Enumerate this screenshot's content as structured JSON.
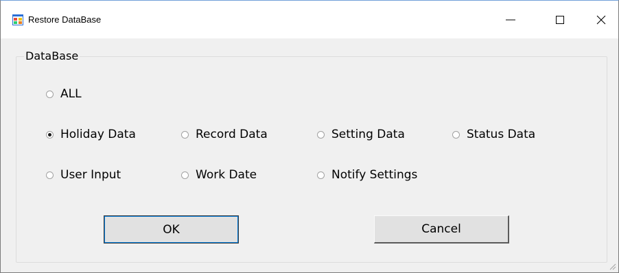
{
  "window": {
    "title": "Restore DataBase",
    "icon": "app-window-icon"
  },
  "titlebar_buttons": {
    "minimize_icon": "minimize-icon",
    "maximize_icon": "maximize-icon",
    "close_icon": "close-icon"
  },
  "group": {
    "label": "DataBase"
  },
  "radios": {
    "all": {
      "label": "ALL",
      "checked": false
    },
    "holiday": {
      "label": "Holiday Data",
      "checked": true
    },
    "record": {
      "label": "Record Data",
      "checked": false
    },
    "setting": {
      "label": "Setting Data",
      "checked": false
    },
    "status": {
      "label": "Status Data",
      "checked": false
    },
    "user_input": {
      "label": "User Input",
      "checked": false
    },
    "work_date": {
      "label": "Work Date",
      "checked": false
    },
    "notify": {
      "label": "Notify Settings",
      "checked": false
    }
  },
  "buttons": {
    "ok": "OK",
    "cancel": "Cancel"
  },
  "colors": {
    "titlebar_bg": "#ffffff",
    "window_bg": "#f0f0f0",
    "accent": "#0078d7"
  }
}
